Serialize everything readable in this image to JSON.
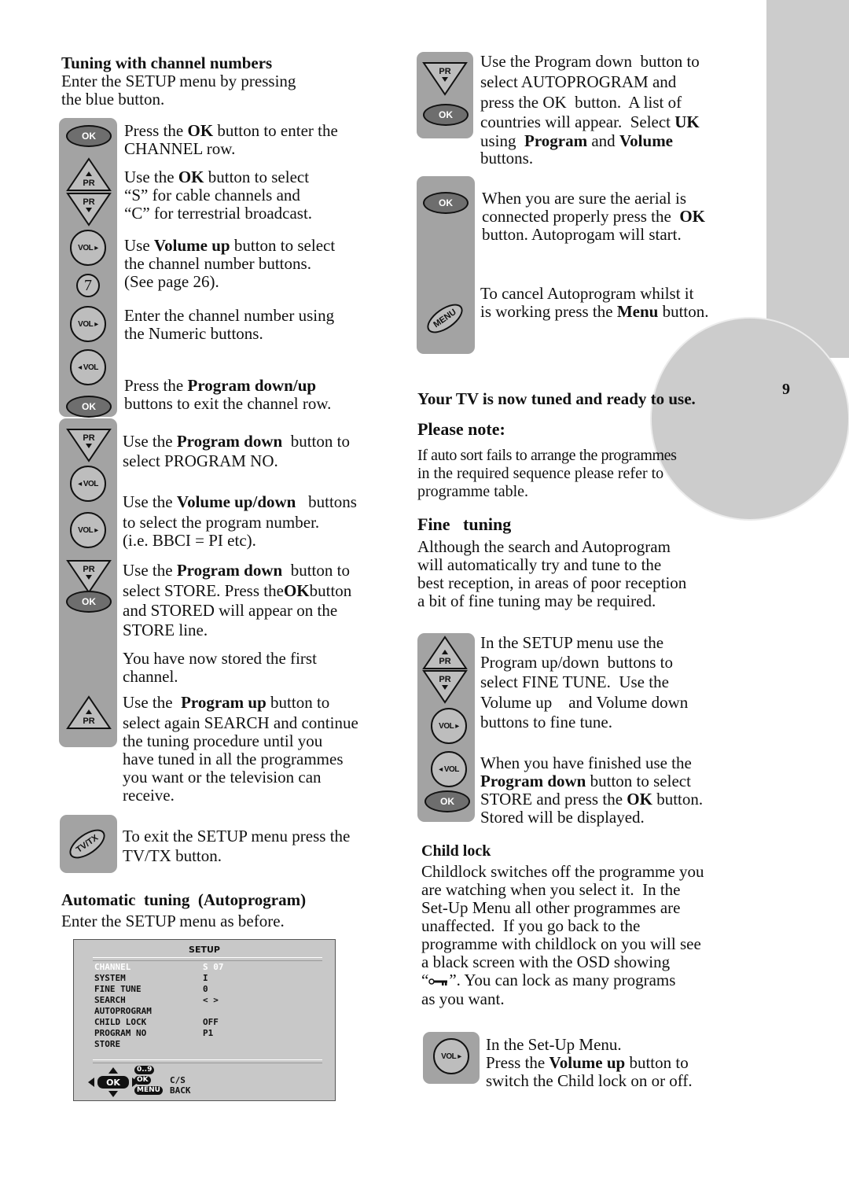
{
  "page": {
    "number": "9"
  },
  "left": {
    "section1": {
      "heading": "Tuning with channel numbers",
      "intro_lines": [
        "Enter the SETUP menu by pressing",
        "the blue button."
      ],
      "steps": [
        {
          "lines": [
            "Press the ",
            "OK",
            " button to enter the",
            "CHANNEL row."
          ]
        },
        {
          "lines": [
            "Use the ",
            "OK",
            " button to select",
            "“S” for cable channels and",
            "“C” for terrestrial broadcast."
          ]
        },
        {
          "lines": [
            "Use ",
            "Volume up",
            " button to select",
            "the channel number buttons.",
            "(See page 26)."
          ]
        },
        {
          "lines": [
            "Enter the channel number using",
            "the Numeric buttons."
          ]
        },
        {
          "lines": [
            "Press the ",
            "Program down/up",
            "buttons to exit the channel row."
          ]
        },
        {
          "lines": [
            "Use the ",
            "Program down",
            "  button to",
            "select PROGRAM NO."
          ]
        },
        {
          "lines": [
            "Use the ",
            "Volume up/down",
            "   buttons",
            "to select the program number.",
            "(i.e. BBCI = PI etc)."
          ]
        },
        {
          "lines": [
            "Use the ",
            "Program down",
            "  button to",
            "select STORE. Press the",
            "OK",
            "button",
            "and STORED will appear on the",
            "STORE line."
          ]
        },
        {
          "lines": [
            "You have now stored the first",
            "channel."
          ]
        },
        {
          "lines": [
            "Use the  ",
            "Program up",
            " button to",
            "select again SEARCH and continue",
            "the tuning procedure until you",
            "have tuned in all the programmes",
            "you want or the television can",
            "receive."
          ]
        },
        {
          "lines": [
            "To exit the SETUP menu press the",
            "TV/TX button."
          ]
        }
      ]
    },
    "section2": {
      "heading": "Automatic  tuning  (Autoprogram)",
      "intro": "Enter the SETUP menu as before."
    },
    "osd": {
      "title": "SETUP",
      "rows": [
        {
          "label": "CHANNEL",
          "value": "S 07",
          "highlighted": true
        },
        {
          "label": "SYSTEM",
          "value": "I"
        },
        {
          "label": "FINE TUNE",
          "value": "0"
        },
        {
          "label": "SEARCH",
          "value": "< >"
        },
        {
          "label": "AUTOPROGRAM",
          "value": ""
        },
        {
          "label": "CHILD LOCK",
          "value": "OFF"
        },
        {
          "label": "PROGRAM NO",
          "value": "P1"
        },
        {
          "label": "STORE",
          "value": ""
        }
      ],
      "footer": {
        "nav_ok": "OK",
        "digits_pill": "0..9",
        "ok_pill": "OK",
        "menu_pill": "MENU",
        "cs_label": "C/S",
        "back_label": "BACK"
      }
    }
  },
  "right": {
    "autoprogram_steps": [
      {
        "lines": [
          "Use the Program down  button to",
          "select AUTOPROGRAM and",
          "press the OK  button.  A list of",
          "countries will appear.  Select ",
          "UK",
          "using  ",
          "Program",
          " and ",
          "Volume",
          "buttons."
        ]
      },
      {
        "lines": [
          "When you are sure the aerial is",
          "connected properly press the  ",
          "OK",
          "button. Autoprogam will start."
        ]
      },
      {
        "lines": [
          "To cancel Autoprogram whilst it",
          "is working press the ",
          "Menu",
          " button."
        ]
      }
    ],
    "ready": "Your TV is now tuned and ready to use.",
    "note_heading": "Please note:",
    "note_lines": [
      "If auto sort fails to arrange the programmes",
      "in the required sequence please refer to",
      "programme table."
    ],
    "fine_heading": "Fine   tuning",
    "fine_lines": [
      "Although the search and Autoprogram",
      "will automatically try and tune to the",
      "best reception, in areas of poor reception",
      "a bit of fine tuning may be required."
    ],
    "fine_steps": [
      {
        "lines": [
          "In the SETUP menu use the",
          "Program up/down  buttons to",
          "select FINE TUNE.  Use the",
          "Volume up    and Volume down",
          "buttons to fine tune."
        ]
      },
      {
        "lines": [
          "When you have finished use the",
          "Program down",
          " button to select",
          "STORE and press the ",
          "OK",
          " button.",
          "Stored will be displayed."
        ]
      }
    ],
    "child_heading": "Child lock",
    "child_lines": [
      "Childlock switches off the programme you",
      "are watching when you select it.  In the",
      "Set-Up Menu all other programmes are",
      "unaffected.  If you go back to the",
      "programme with childlock on you will see",
      "a black screen with the OSD showing",
      "“",
      "key-symbol",
      "”. You can lock as many programs",
      "as you want."
    ],
    "child_step": {
      "lines": [
        "In the Set-Up Menu.",
        "Press the ",
        "Volume up",
        " button to",
        "switch the Child lock on or off."
      ]
    }
  },
  "icons": {
    "ok": "OK",
    "pr": "PR",
    "vol_up": "VOL ▸",
    "vol_down": "◂ VOL",
    "seven": "7",
    "tvtx": "TV/TX",
    "menu": "MENU"
  }
}
